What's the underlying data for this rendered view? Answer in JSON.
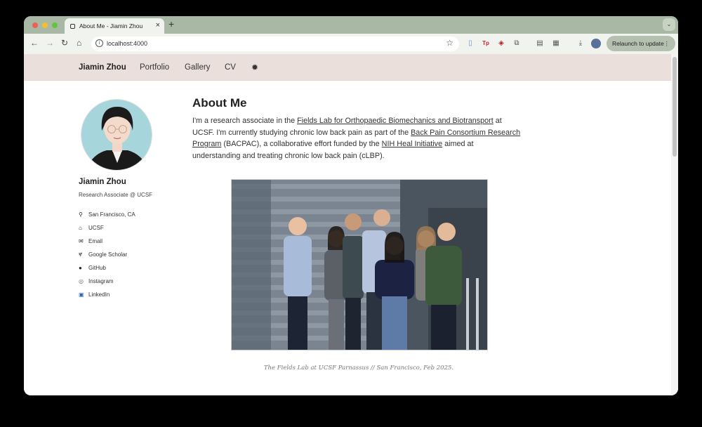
{
  "browser": {
    "tab_title": "About Me - Jiamin Zhou",
    "tab_close": "×",
    "new_tab": "+",
    "tab_menu": "⌄",
    "url": "localhost:4000",
    "relaunch_label": "Relaunch to update",
    "relaunch_menu": "⋮",
    "nav": {
      "back": "←",
      "forward": "→",
      "reload": "↻",
      "home": "⌂",
      "info": "i",
      "star": "☆"
    },
    "extensions": [
      {
        "name": "document-extension-icon",
        "glyph": "▯"
      },
      {
        "name": "tp-extension-icon",
        "glyph": "Tp"
      },
      {
        "name": "shield-extension-icon",
        "glyph": "◈"
      },
      {
        "name": "puzzle-extension-icon",
        "glyph": "⧉"
      },
      {
        "name": "trash-extension-icon",
        "glyph": "▤"
      },
      {
        "name": "sidepanel-icon",
        "glyph": "▦"
      },
      {
        "name": "download-icon",
        "glyph": "⤓"
      }
    ]
  },
  "masthead": {
    "brand": "Jiamin Zhou",
    "links": [
      "Portfolio",
      "Gallery",
      "CV"
    ],
    "theme_icon": "✹"
  },
  "author": {
    "name": "Jiamin Zhou",
    "bio": "Research Associate @ UCSF",
    "links": [
      {
        "icon": "map-marker-icon",
        "glyph": "⚲",
        "label": "San Francisco, CA"
      },
      {
        "icon": "university-icon",
        "glyph": "⌂",
        "label": "UCSF"
      },
      {
        "icon": "envelope-icon",
        "glyph": "✉",
        "label": "Email"
      },
      {
        "icon": "google-scholar-icon",
        "glyph": "ኛ",
        "label": "Google Scholar"
      },
      {
        "icon": "github-icon",
        "glyph": "●",
        "label": "GitHub"
      },
      {
        "icon": "instagram-icon",
        "glyph": "◎",
        "label": "Instagram"
      },
      {
        "icon": "linkedin-icon",
        "glyph": "▣",
        "label": "LinkedIn"
      }
    ]
  },
  "content": {
    "title": "About Me",
    "p_text1": "I'm a research associate in the ",
    "p_link1": "Fields Lab for Orthopaedic Biomechanics and Biotransport",
    "p_text2": " at UCSF. I'm currently studying chronic low back pain as part of the ",
    "p_link2": "Back Pain Consortium Research Program",
    "p_text3": " (BACPAC), a collaborative effort funded by the ",
    "p_link3": "NIH Heal Initiative",
    "p_text4": " aimed at understanding and treating chronic low back pain (cLBP).",
    "caption": "The Fields Lab at UCSF Parnassus // San Francisco, Feb 2025."
  },
  "colors": {
    "tabbar": "#a9b8a4",
    "masthead": "#ebdfdc",
    "traffic_red": "#ee5f57",
    "traffic_yellow": "#f5bd2f",
    "traffic_green": "#5fc73f"
  }
}
